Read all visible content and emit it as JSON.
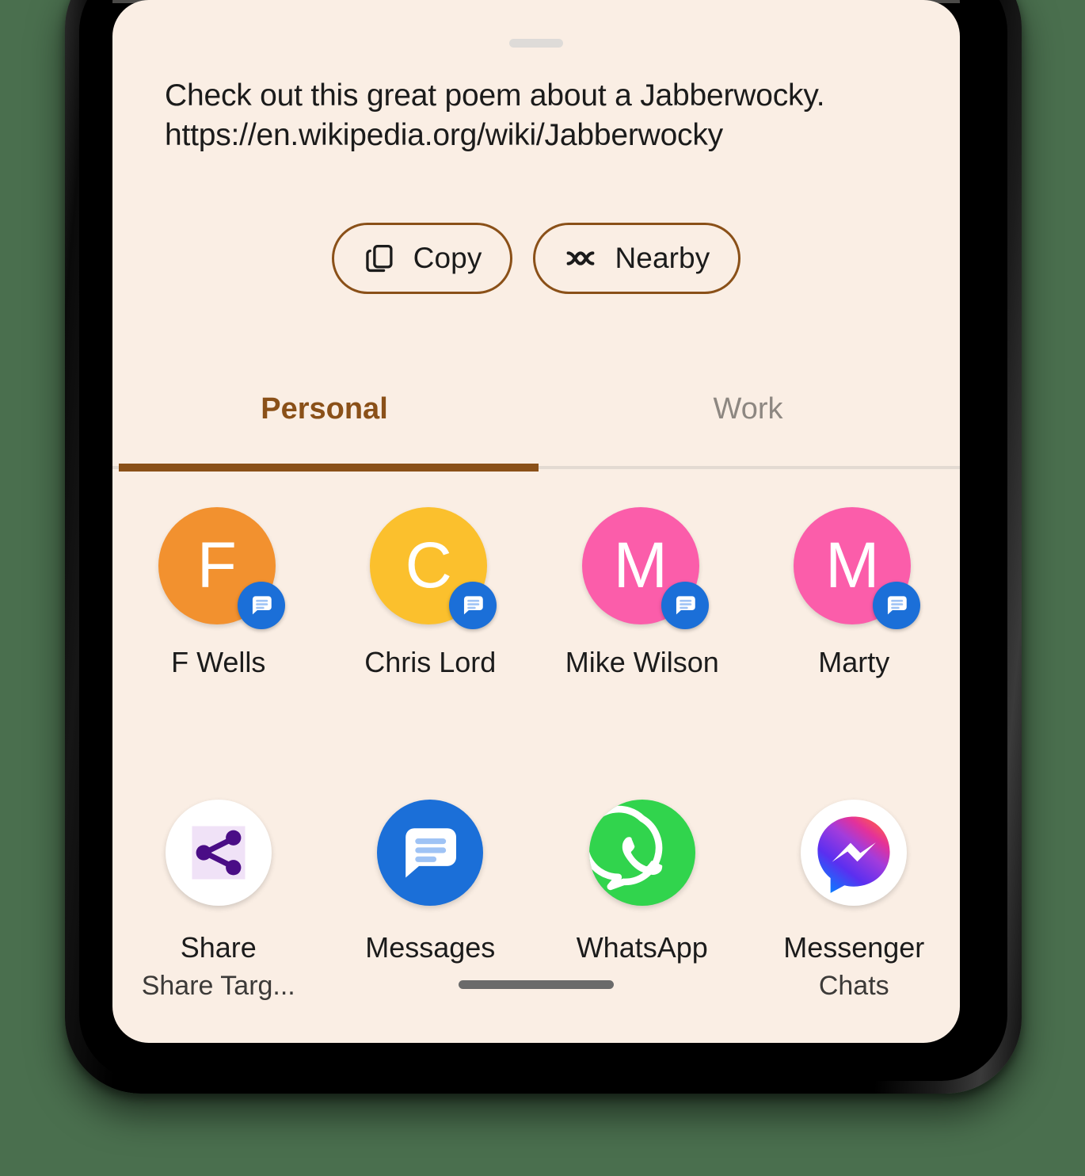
{
  "sheet": {
    "background_color": "#faeee4",
    "accent_color": "#8a5018",
    "drag_handle": "drag-handle"
  },
  "preview": {
    "line1": "Check out this great poem about a Jabberwocky.",
    "line2": "https://en.wikipedia.org/wiki/Jabberwocky"
  },
  "actions": [
    {
      "label": "Copy",
      "icon": "copy-icon"
    },
    {
      "label": "Nearby",
      "icon": "nearby-share-icon"
    }
  ],
  "tabs": [
    {
      "label": "Personal",
      "selected": true
    },
    {
      "label": "Work",
      "selected": false
    }
  ],
  "contacts": [
    {
      "name": "F Wells",
      "initial": "F",
      "color": "#f2912f",
      "badge": "messages-icon"
    },
    {
      "name": "Chris Lord",
      "initial": "C",
      "color": "#fbc02d",
      "badge": "messages-icon"
    },
    {
      "name": "Mike Wilson",
      "initial": "M",
      "color": "#fb5daa",
      "badge": "messages-icon"
    },
    {
      "name": "Marty",
      "initial": "M",
      "color": "#fb5daa",
      "badge": "messages-icon"
    }
  ],
  "apps": [
    {
      "name": "Share",
      "sublabel": "Share Targ...",
      "icon": "share-nodes-icon"
    },
    {
      "name": "Messages",
      "sublabel": "",
      "icon": "messages-app-icon"
    },
    {
      "name": "WhatsApp",
      "sublabel": "",
      "icon": "whatsapp-icon"
    },
    {
      "name": "Messenger",
      "sublabel": "Chats",
      "icon": "messenger-icon"
    }
  ],
  "system": {
    "home_indicator": "home-indicator"
  }
}
